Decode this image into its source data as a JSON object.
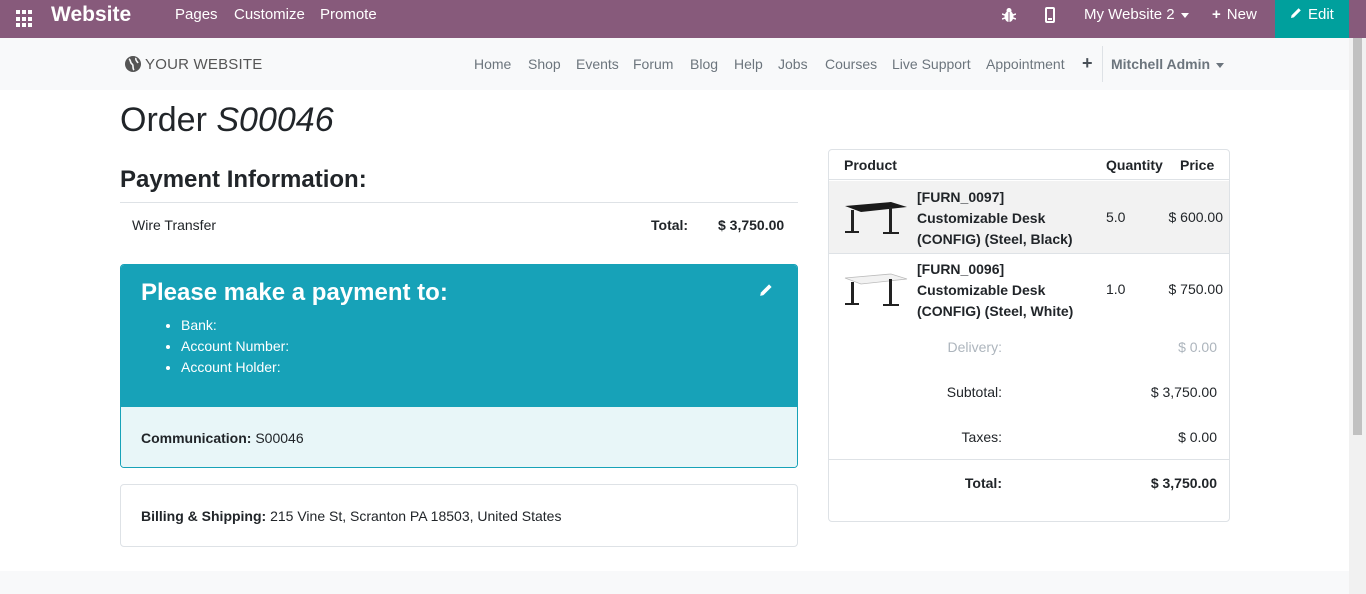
{
  "topbar": {
    "brand": "Website",
    "menu": [
      "Pages",
      "Customize",
      "Promote"
    ],
    "site_selector": "My Website 2",
    "new_label": "New",
    "edit_label": "Edit",
    "colors": {
      "bar": "#875a7b",
      "edit": "#00a09d"
    }
  },
  "site_header": {
    "logo_text": "YOUR WEBSITE",
    "nav": [
      "Home",
      "Shop",
      "Events",
      "Forum",
      "Blog",
      "Help",
      "Jobs",
      "Courses",
      "Live Support",
      "Appointment"
    ],
    "plus": "+",
    "user": "Mitchell Admin"
  },
  "order": {
    "title_prefix": "Order",
    "number": "S00046"
  },
  "payment": {
    "heading": "Payment Information:",
    "method": "Wire Transfer",
    "total_label": "Total:",
    "total_value": "$ 3,750.00"
  },
  "payment_box": {
    "heading": "Please make a payment to:",
    "items": [
      "Bank:",
      "Account Number:",
      "Account Holder:"
    ],
    "communication_label": "Communication:",
    "communication_value": "S00046",
    "color": "#17a2b8"
  },
  "billing": {
    "label": "Billing & Shipping:",
    "address": "215 Vine St, Scranton PA 18503, United States"
  },
  "summary": {
    "headers": {
      "product": "Product",
      "quantity": "Quantity",
      "price": "Price"
    },
    "products": [
      {
        "name": "[FURN_0097] Customizable Desk (CONFIG) (Steel, Black)",
        "quantity": "5.0",
        "price": "$ 600.00",
        "color": "black"
      },
      {
        "name": "[FURN_0096] Customizable Desk (CONFIG) (Steel, White)",
        "quantity": "1.0",
        "price": "$ 750.00",
        "color": "white"
      }
    ],
    "delivery_label": "Delivery:",
    "delivery_value": "$ 0.00",
    "subtotal_label": "Subtotal:",
    "subtotal_value": "$ 3,750.00",
    "taxes_label": "Taxes:",
    "taxes_value": "$ 0.00",
    "total_label": "Total:",
    "total_value": "$ 3,750.00"
  }
}
